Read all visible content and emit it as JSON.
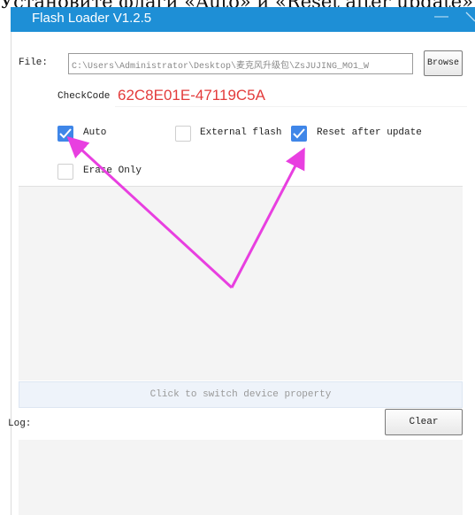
{
  "caption": "Установите флаги «Auto» и «Reset after update»",
  "window": {
    "title": "Flash Loader V1.2.5",
    "minimize_label": "—"
  },
  "file": {
    "label": "File:",
    "path": "C:\\Users\\Administrator\\Desktop\\麦克风升级包\\ZsJUJING_MO1_W",
    "browse_label": "Browse"
  },
  "checkcode": {
    "label": "CheckCode",
    "value": "62C8E01E-47119C5A"
  },
  "options": {
    "auto": {
      "label": "Auto",
      "checked": true
    },
    "external_flash": {
      "label": "External flash",
      "checked": false
    },
    "reset_after_update": {
      "label": "Reset after update",
      "checked": true
    },
    "erase_only": {
      "label": "Erase Only",
      "checked": false
    }
  },
  "device": {
    "switch_label": "Click to switch device property"
  },
  "log": {
    "label": "Log:",
    "clear_label": "Clear"
  },
  "colors": {
    "titlebar": "#1e8fd6",
    "checkbox_checked": "#3f86e8",
    "checkcode_text": "#e33b3b",
    "annotation_arrow": "#e83fe0"
  }
}
